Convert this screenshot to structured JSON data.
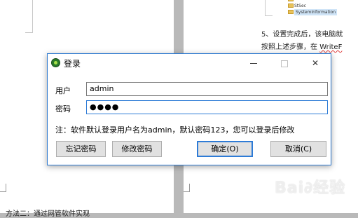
{
  "dialog": {
    "title": "登录",
    "user_label": "用户",
    "user_value": "admin",
    "password_label": "密码",
    "password_value": "●●●●",
    "note": "注：软件默认登录用户名为admin，默认密码123，您可以登录后修改",
    "buttons": {
      "forgot": "忘记密码",
      "change": "修改密码",
      "ok": "确定(O)",
      "cancel": "取消(C)"
    },
    "titlebar_buttons": {
      "close": "✕"
    }
  },
  "background": {
    "tree_items": [
      "",
      "StSec",
      "SystemInformation"
    ],
    "doc_line_1": "5、设置完成后，该电脑就",
    "doc_line_2_prefix": "按照上述步骤，在 ",
    "doc_line_2_wavy": "WriteF",
    "bottom_text": "方法二：通过网管软件实现",
    "watermark": "Bai∂经验"
  },
  "colors": {
    "accent": "#2e7bd6",
    "window_border": "#2b79d0",
    "button_face": "#e1e1e1"
  }
}
